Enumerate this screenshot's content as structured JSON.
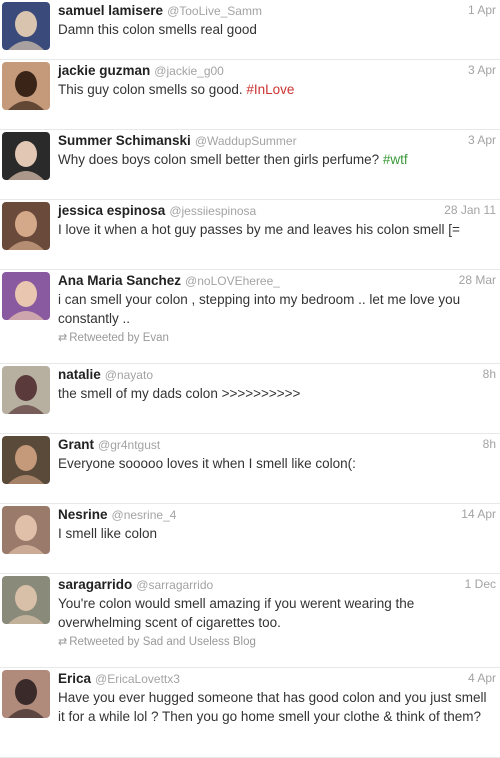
{
  "tweets": [
    {
      "name": "samuel lamisere",
      "handle": "@TooLive_Samm",
      "time": "1 Apr",
      "text": "Damn this colon smells real good",
      "hashtag": "",
      "retweet": "",
      "avatar_bg": "#3a4a7a",
      "avatar_fg": "#d9c4b0"
    },
    {
      "name": "jackie guzman",
      "handle": "@jackie_g00",
      "time": "3 Apr",
      "text": "This guy colon smells so good. ",
      "hashtag": "#InLove",
      "retweet": "",
      "avatar_bg": "#c49a7a",
      "avatar_fg": "#3a2418"
    },
    {
      "name": "Summer Schimanski",
      "handle": "@WaddupSummer",
      "time": "3 Apr",
      "text": "Why does boys colon smell better then girls perfume? ",
      "hashtag": "#wtf",
      "retweet": "",
      "avatar_bg": "#2a2a2a",
      "avatar_fg": "#e2c7b4"
    },
    {
      "name": "jessica espinosa",
      "handle": "@jessiiespinosa",
      "time": "28 Jan 11",
      "text": "I love it when a hot guy passes by me and leaves his colon smell [=",
      "hashtag": "",
      "retweet": "",
      "avatar_bg": "#6a4a3a",
      "avatar_fg": "#d4a98a"
    },
    {
      "name": "Ana Maria Sanchez",
      "handle": "@noLOVEheree_",
      "time": "28 Mar",
      "text": "i can smell your colon , stepping into my bedroom .. let me love you constantly ..",
      "hashtag": "",
      "retweet": "Retweeted by Evan",
      "avatar_bg": "#8a5aa0",
      "avatar_fg": "#e8c6b0"
    },
    {
      "name": "natalie",
      "handle": "@nayato",
      "time": "8h",
      "text": "the smell of my dads colon >>>>>>>>>>",
      "hashtag": "",
      "retweet": "",
      "avatar_bg": "#b7b0a0",
      "avatar_fg": "#5a3a3a"
    },
    {
      "name": "Grant",
      "handle": "@gr4ntgust",
      "time": "8h",
      "text": "Everyone sooooo loves it when I smell like colon(:",
      "hashtag": "",
      "retweet": "",
      "avatar_bg": "#5a4a3a",
      "avatar_fg": "#c49a7a"
    },
    {
      "name": "Nesrine",
      "handle": "@nesrine_4",
      "time": "14 Apr",
      "text": "I smell like colon",
      "hashtag": "",
      "retweet": "",
      "avatar_bg": "#9a7a6a",
      "avatar_fg": "#e0c0a8"
    },
    {
      "name": "saragarrido",
      "handle": "@sarragarrido",
      "time": "1 Dec",
      "text": "You're colon would smell amazing if you werent wearing the overwhelming scent of cigarettes too.",
      "hashtag": "",
      "retweet": "Retweeted by Sad and Useless Blog",
      "avatar_bg": "#8a8a7a",
      "avatar_fg": "#d8c0a8"
    },
    {
      "name": "Erica",
      "handle": "@EricaLovettx3",
      "time": "4 Apr",
      "text": "Have you ever hugged someone that has good colon and you just smell it for a while lol ? Then you go home smell your clothe & think of them?",
      "hashtag": "",
      "retweet": "",
      "avatar_bg": "#b08a7a",
      "avatar_fg": "#3a2a2a"
    }
  ],
  "icons": {
    "retweet": "retweet-icon"
  }
}
